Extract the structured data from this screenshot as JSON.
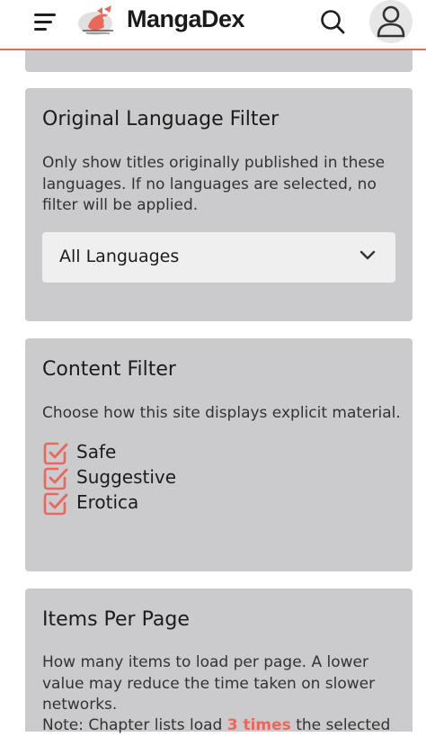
{
  "header": {
    "brand": "MangaDex",
    "icons": {
      "menu": "hamburger-menu-icon",
      "search": "search-icon",
      "account": "user-icon"
    },
    "colors": {
      "accent": "#e9675b"
    }
  },
  "language_filter": {
    "title": "Original Language Filter",
    "description": "Only show titles originally published in these languages. If no languages are selected, no filter will be applied.",
    "selected": "All Languages"
  },
  "content_filter": {
    "title": "Content Filter",
    "description": "Choose how this site displays explicit material.",
    "options": [
      {
        "label": "Safe",
        "checked": true
      },
      {
        "label": "Suggestive",
        "checked": true
      },
      {
        "label": "Erotica",
        "checked": true
      }
    ]
  },
  "items_per_page": {
    "title": "Items Per Page",
    "description": "How many items to load per page. A lower value may reduce the time taken on slower networks.",
    "note_prefix": "Note: Chapter lists load ",
    "note_highlight": "3 times",
    "note_suffix": " the selected"
  }
}
